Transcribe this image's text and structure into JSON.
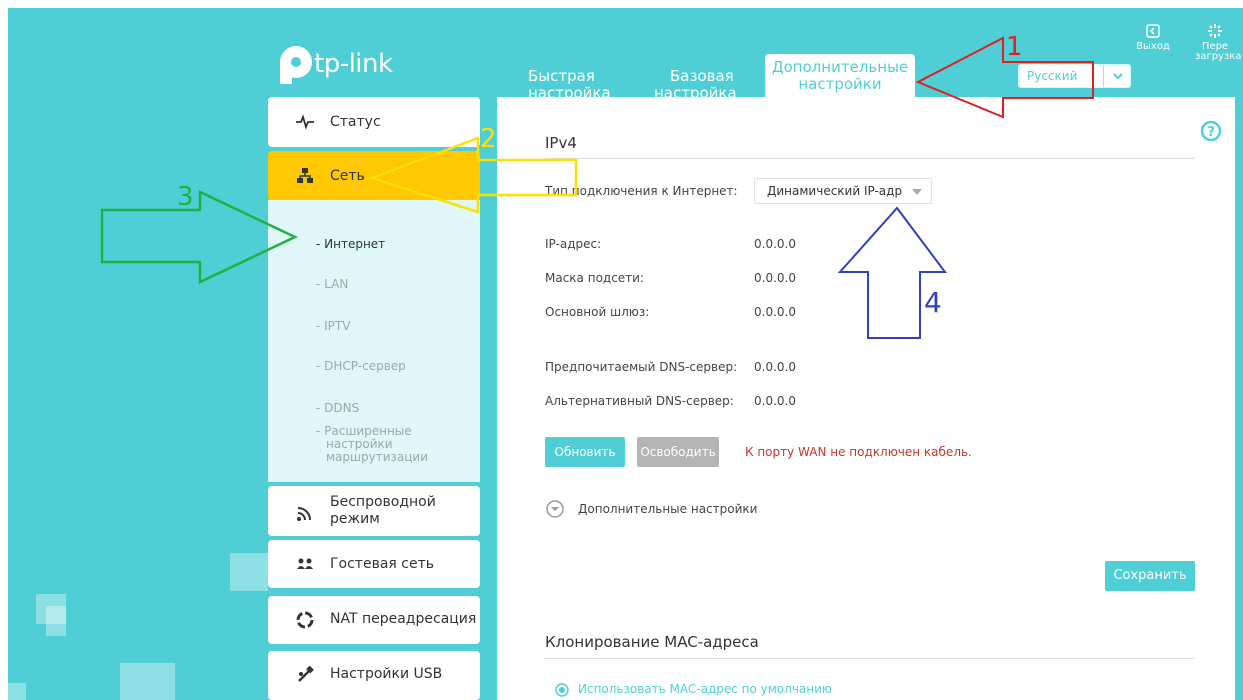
{
  "brand": {
    "name": "tp-link"
  },
  "tabs": [
    {
      "line1": "Быстрая",
      "line2": "настройка"
    },
    {
      "line1": "Базовая",
      "line2": "настройка"
    },
    {
      "line1": "Дополнительные",
      "line2": "настройки"
    }
  ],
  "language": {
    "value": "Русский"
  },
  "top_actions": {
    "logout": "Выход",
    "reboot_line1": "Пере",
    "reboot_line2": "загрузка"
  },
  "sidebar": {
    "status": "Статус",
    "network": "Сеть",
    "sub_items": [
      "- Интернет",
      "- LAN",
      "- IPTV",
      "- DHCP-сервер",
      "- DDNS"
    ],
    "routing_line1": "- Расширенные",
    "routing_line2": "настройки",
    "routing_line3": "маршрутизации",
    "wireless_line1": "Беспроводной",
    "wireless_line2": "режим",
    "guest": "Гостевая сеть",
    "nat": "NAT переадресация",
    "usb": "Настройки USB"
  },
  "ipv4": {
    "title": "IPv4",
    "conn_type_label": "Тип подключения к Интернет:",
    "conn_type_value": "Динамический IP-адр",
    "ip_label": "IP-адрес:",
    "ip_value": "0.0.0.0",
    "mask_label": "Маска подсети:",
    "mask_value": "0.0.0.0",
    "gateway_label": "Основной шлюз:",
    "gateway_value": "0.0.0.0",
    "dns1_label": "Предпочитаемый DNS-сервер:",
    "dns1_value": "0.0.0.0",
    "dns2_label": "Альтернативный DNS-сервер:",
    "dns2_value": "0.0.0.0",
    "renew": "Обновить",
    "release": "Освободить",
    "wan_warning": "К порту WAN не подключен кабель.",
    "advanced": "Дополнительные настройки",
    "save": "Сохранить"
  },
  "mac": {
    "title": "Клонирование MAC-адреса",
    "option_default": "Использовать MAC-адрес по умолчанию"
  },
  "annotations": {
    "n1": "1",
    "n2": "2",
    "n3": "3",
    "n4": "4"
  },
  "colors": {
    "brand": "#4fcfd5",
    "active": "#ffc800",
    "warning": "#c0392b"
  }
}
